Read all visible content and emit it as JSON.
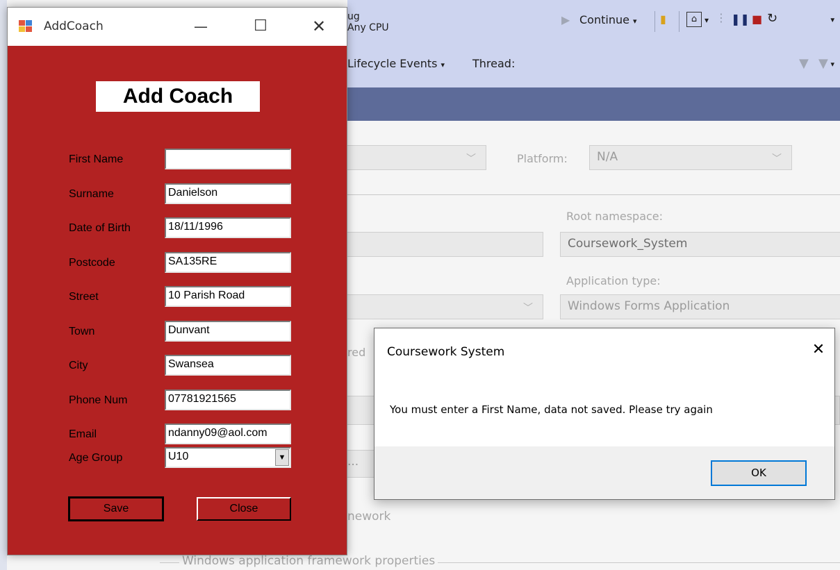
{
  "vs": {
    "toolbar": {
      "config_fragment": "ug",
      "platform_combo": "Any CPU",
      "continue_label": "Continue",
      "lifecycle_label": "Lifecycle Events",
      "thread_label": "Thread:"
    },
    "props": {
      "platform_label": "Platform:",
      "platform_value": "N/A",
      "root_namespace_label": "Root namespace:",
      "root_namespace_value": "Coursework_System",
      "app_type_label": "Application type:",
      "app_type_value": "Windows Forms Application",
      "redir_fragment": "red",
      "ellipsis": "...",
      "framework_fragment": "nework",
      "framework_props_label": "Windows application framework properties"
    }
  },
  "addcoach": {
    "window_title": "AddCoach",
    "heading": "Add Coach",
    "fields": [
      {
        "label": "First Name",
        "value": ""
      },
      {
        "label": "Surname",
        "value": "Danielson"
      },
      {
        "label": "Date of Birth",
        "value": "18/11/1996"
      },
      {
        "label": "Postcode",
        "value": "SA135RE"
      },
      {
        "label": "Street",
        "value": "10 Parish Road"
      },
      {
        "label": "Town",
        "value": "Dunvant"
      },
      {
        "label": "City",
        "value": "Swansea"
      },
      {
        "label": "Phone Num",
        "value": "07781921565"
      },
      {
        "label": "Email",
        "value": "ndanny09@aol.com"
      }
    ],
    "age_group": {
      "label": "Age Group",
      "value": "U10"
    },
    "save_label": "Save",
    "close_label": "Close",
    "colors": {
      "background": "#b22222"
    }
  },
  "messagebox": {
    "title": "Coursework System",
    "message": "You must enter a First Name, data not saved. Please try again",
    "ok_label": "OK"
  }
}
